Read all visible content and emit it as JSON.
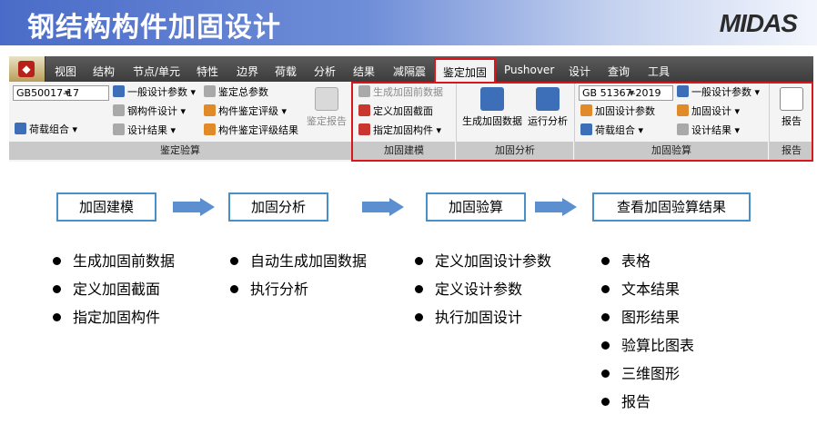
{
  "title": "钢结构构件加固设计",
  "logo": "MIDAS",
  "menu": [
    "视图",
    "结构",
    "节点/单元",
    "特性",
    "边界",
    "荷载",
    "分析",
    "结果",
    "减隔震",
    "鉴定加固",
    "Pushover",
    "设计",
    "查询",
    "工具"
  ],
  "active_menu": "鉴定加固",
  "ribbon": {
    "appraisal": {
      "code_select": "GB50017-17",
      "load_combo": "荷载组合",
      "general_params": "一般设计参数",
      "member_design": "钢构件设计",
      "design_results": "设计结果",
      "total_params": "鉴定总参数",
      "member_rating": "构件鉴定评级",
      "rating_results": "构件鉴定评级结果",
      "report": "鉴定报告",
      "footer": "鉴定验算"
    },
    "modeling": {
      "pre_data": "生成加固前数据",
      "define_section": "定义加固截面",
      "assign_member": "指定加固构件",
      "footer": "加固建模"
    },
    "analysis": {
      "gen_data": "生成加固数据",
      "run": "运行分析",
      "footer": "加固分析"
    },
    "check": {
      "code_select": "GB 51367-2019",
      "design_params": "加固设计参数",
      "load_combo": "荷载组合",
      "general_params": "一般设计参数",
      "reinforce_design": "加固设计",
      "design_results": "设计结果",
      "footer": "加固验算"
    },
    "report": {
      "label": "报告",
      "footer": "报告"
    }
  },
  "flow": {
    "steps": [
      "加固建模",
      "加固分析",
      "加固验算",
      "查看加固验算结果"
    ],
    "columns": [
      [
        "生成加固前数据",
        "定义加固截面",
        "指定加固构件"
      ],
      [
        "自动生成加固数据",
        "执行分析"
      ],
      [
        "定义加固设计参数",
        "定义设计参数",
        "执行加固设计"
      ],
      [
        "表格",
        "文本结果",
        "图形结果",
        "验算比图表",
        "三维图形",
        "报告"
      ]
    ]
  },
  "colors": {
    "banner": "#4a6cc8",
    "highlight": "#d9171b",
    "step_border": "#4a90c8",
    "arrow": "#5b8fd0"
  }
}
